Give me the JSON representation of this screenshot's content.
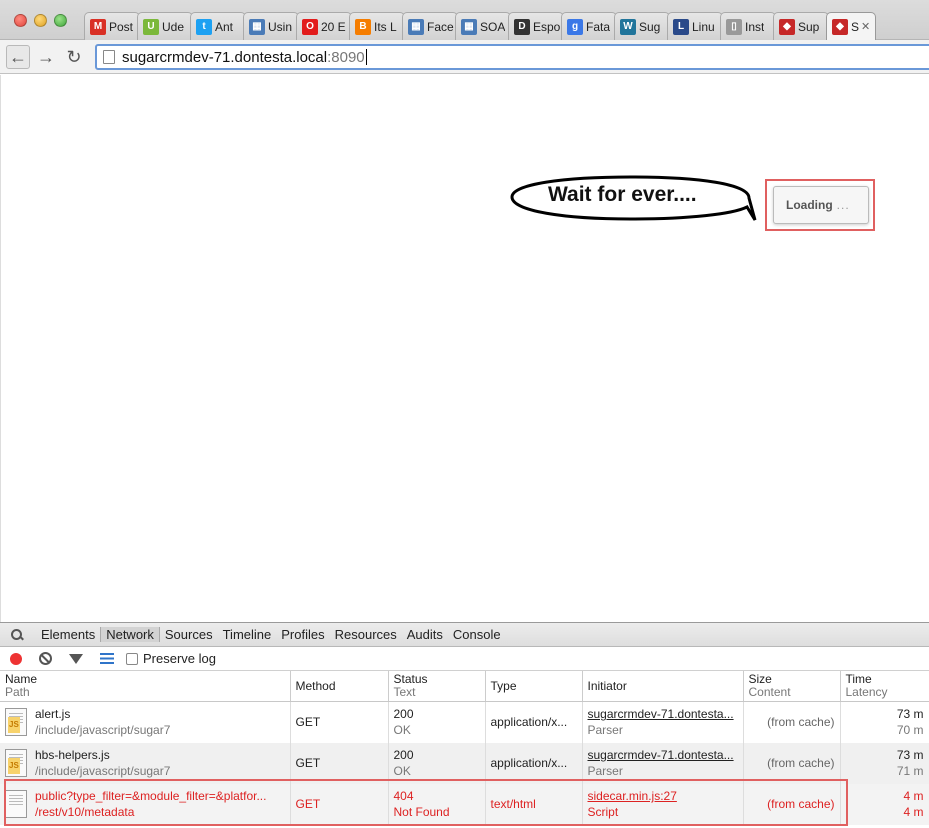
{
  "browser": {
    "tabs": [
      {
        "label": "Post",
        "icon": "gmail-icon",
        "color": "#d93025",
        "glyph": "M"
      },
      {
        "label": "Ude",
        "icon": "udemy-icon",
        "color": "#7bb83a",
        "glyph": "U"
      },
      {
        "label": "Ant",
        "icon": "twitter-icon",
        "color": "#1da1f2",
        "glyph": "t"
      },
      {
        "label": "Usin",
        "icon": "stackoverflow-icon",
        "color": "#4a7bb7",
        "glyph": "▦"
      },
      {
        "label": "20 E",
        "icon": "oracle-icon",
        "color": "#e21c1c",
        "glyph": "O"
      },
      {
        "label": "Its L",
        "icon": "blogger-icon",
        "color": "#f57d00",
        "glyph": "B"
      },
      {
        "label": "Face",
        "icon": "stackoverflow-icon",
        "color": "#4a7bb7",
        "glyph": "▦"
      },
      {
        "label": "SOA",
        "icon": "stackoverflow-icon",
        "color": "#4a7bb7",
        "glyph": "▦"
      },
      {
        "label": "Espo",
        "icon": "dzone-icon",
        "color": "#333333",
        "glyph": "D"
      },
      {
        "label": "Fata",
        "icon": "google-icon",
        "color": "#3b78e7",
        "glyph": "g"
      },
      {
        "label": "Sug",
        "icon": "wordpress-icon",
        "color": "#21759b",
        "glyph": "W"
      },
      {
        "label": "Linu",
        "icon": "linux-icon",
        "color": "#2a4a8a",
        "glyph": "L"
      },
      {
        "label": "Inst",
        "icon": "page-icon",
        "color": "#999999",
        "glyph": "▯"
      },
      {
        "label": "Sup",
        "icon": "sugarcrm-icon",
        "color": "#c62828",
        "glyph": "◆"
      },
      {
        "label": "S",
        "icon": "sugarcrm-icon",
        "color": "#c62828",
        "glyph": "◆",
        "active": true
      }
    ],
    "close_glyph": "✕",
    "url_host": "sugarcrmdev-71.dontesta.local",
    "url_port": ":8090"
  },
  "page": {
    "bubble_text": "Wait for ever....",
    "loading_label": "Loading",
    "loading_dots": "...",
    "highlight_color": "#e06060"
  },
  "devtools": {
    "tabs": [
      "Elements",
      "Network",
      "Sources",
      "Timeline",
      "Profiles",
      "Resources",
      "Audits",
      "Console"
    ],
    "active_tab": "Network",
    "preserve_log": "Preserve log",
    "columns": {
      "name": "Name",
      "name_sub": "Path",
      "method": "Method",
      "status": "Status",
      "status_sub": "Text",
      "type": "Type",
      "initiator": "Initiator",
      "size": "Size",
      "size_sub": "Content",
      "time": "Time",
      "time_sub": "Latency"
    },
    "rows": [
      {
        "name": "alert.js",
        "path": "/include/javascript/sugar7",
        "method": "GET",
        "status": "200",
        "status_text": "OK",
        "type": "application/x...",
        "initiator": "sugarcrmdev-71.dontesta...",
        "initiator_sub": "Parser",
        "size": "(from cache)",
        "time": "73 m",
        "latency": "70 m"
      },
      {
        "name": "hbs-helpers.js",
        "path": "/include/javascript/sugar7",
        "method": "GET",
        "status": "200",
        "status_text": "OK",
        "type": "application/x...",
        "initiator": "sugarcrmdev-71.dontesta...",
        "initiator_sub": "Parser",
        "size": "(from cache)",
        "time": "73 m",
        "latency": "71 m"
      },
      {
        "name": "public?type_filter=&module_filter=&platfor...",
        "path": "/rest/v10/metadata",
        "method": "GET",
        "status": "404",
        "status_text": "Not Found",
        "type": "text/html",
        "initiator": "sidecar.min.js:27",
        "initiator_sub": "Script",
        "size": "(from cache)",
        "time": "4 m",
        "latency": "4 m"
      }
    ]
  }
}
